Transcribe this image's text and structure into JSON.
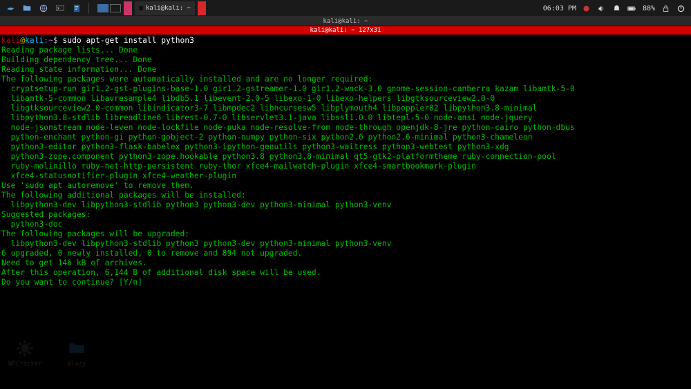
{
  "panel": {
    "tasks": [
      {
        "label": ""
      },
      {
        "label": "kali@kali: ~"
      },
      {
        "label": ""
      }
    ],
    "clock": "06:03 PM",
    "battery": "88%"
  },
  "window": {
    "title": "kali@kali: ~",
    "subtitle": "kali@kali: ~ 127x31"
  },
  "prompt": {
    "user": "kali",
    "at": "@",
    "host": "kali",
    "colon": ":",
    "pwd": "~",
    "dollar": "$ ",
    "command": "sudo apt-get install python3"
  },
  "lines": {
    "l01": "Reading package lists... Done",
    "l02": "Building dependency tree... Done",
    "l03": "Reading state information... Done",
    "l04": "The following packages were automatically installed and are no longer required:",
    "l05": "  cryptsetup-run gir1.2-gst-plugins-base-1.0 gir1.2-gstreamer-1.0 gir1.2-wnck-3.0 gnome-session-canberra kazam libamtk-5-0",
    "l06": "  libamtk-5-common libavresample4 libdb5.1 libevent-2.0-5 libexo-1-0 libexo-helpers libgtksourceview2.0-0",
    "l07": "  libgtksourceview2.0-common libindicator3-7 libmpdec2 libncursesw5 libplymouth4 libpoppler82 libpython3.8-minimal",
    "l08": "  libpython3.8-stdlib libreadline6 librest-0.7-0 libservlet3.1-java libssl1.0.0 libtepl-5-0 node-ansi node-jquery",
    "l09": "  node-jsonstream node-leven node-lockfile node-puka node-resolve-from node-through openjdk-8-jre python-cairo python-dbus",
    "l10": "  python-enchant python-gi python-gobject-2 python-numpy python-six python2.6 python2.6-minimal python3-chameleon",
    "l11": "  python3-editor python3-flask-babelex python3-ipython-genutils python3-waitress python3-webtest python3-xdg",
    "l12": "  python3-zope.component python3-zope.hookable python3.8 python3.8-minimal qt5-gtk2-platformtheme ruby-connection-pool",
    "l13": "  ruby-molinillo ruby-net-http-persistent ruby-thor xfce4-mailwatch-plugin xfce4-smartbookmark-plugin",
    "l14": "  xfce4-statusnotifier-plugin xfce4-weather-plugin",
    "l15": "Use 'sudo apt autoremove' to remove them.",
    "l16": "The following additional packages will be installed:",
    "l17": "  libpython3-dev libpython3-stdlib python3 python3-dev python3-minimal python3-venv",
    "l18": "Suggested packages:",
    "l19": "  python3-doc",
    "l20": "The following packages will be upgraded:",
    "l21": "  libpython3-dev libpython3-stdlib python3 python3-dev python3-minimal python3-venv",
    "l22": "6 upgraded, 0 newly installed, 0 to remove and 894 not upgraded.",
    "l23": "Need to get 146 kB of archives.",
    "l24": "After this operation, 6,144 B of additional disk space will be used.",
    "l25": "Do you want to continue? [Y/n] "
  },
  "desktop": {
    "icon1": "WPCracker",
    "icon2": "Blazy"
  }
}
